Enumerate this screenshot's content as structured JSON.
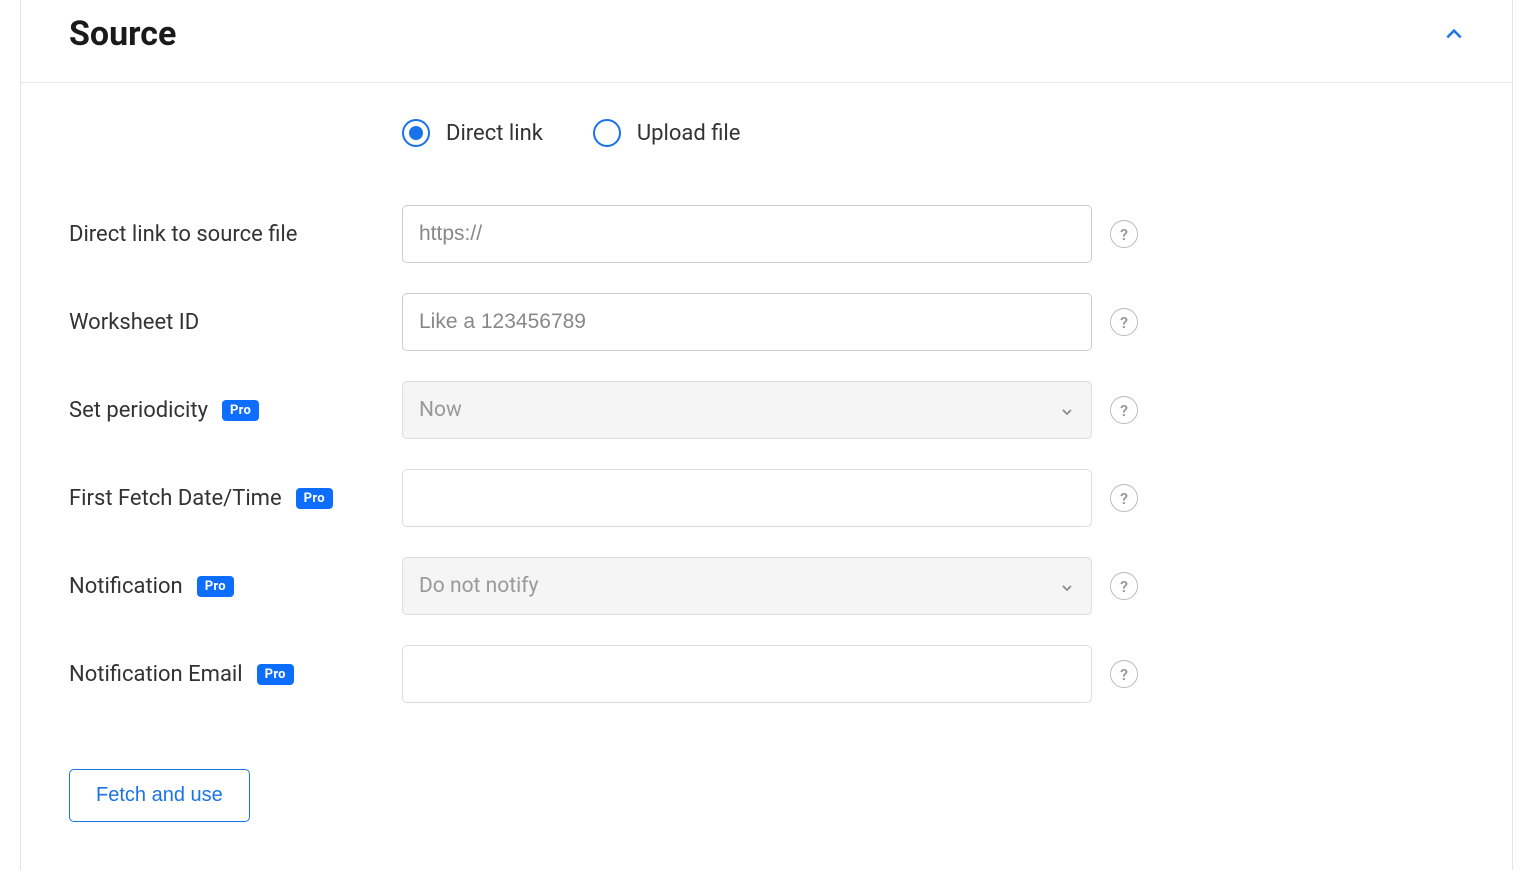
{
  "panel": {
    "title": "Source"
  },
  "radios": {
    "direct_link": "Direct link",
    "upload_file": "Upload file"
  },
  "fields": {
    "direct_link": {
      "label": "Direct link to source file",
      "placeholder": "https://"
    },
    "worksheet_id": {
      "label": "Worksheet ID",
      "placeholder": "Like a 123456789"
    },
    "periodicity": {
      "label": "Set periodicity",
      "value": "Now",
      "pro": "Pro"
    },
    "first_fetch": {
      "label": "First Fetch Date/Time",
      "pro": "Pro"
    },
    "notification": {
      "label": "Notification",
      "value": "Do not notify",
      "pro": "Pro"
    },
    "notification_email": {
      "label": "Notification Email",
      "pro": "Pro"
    }
  },
  "buttons": {
    "fetch": "Fetch and use"
  }
}
